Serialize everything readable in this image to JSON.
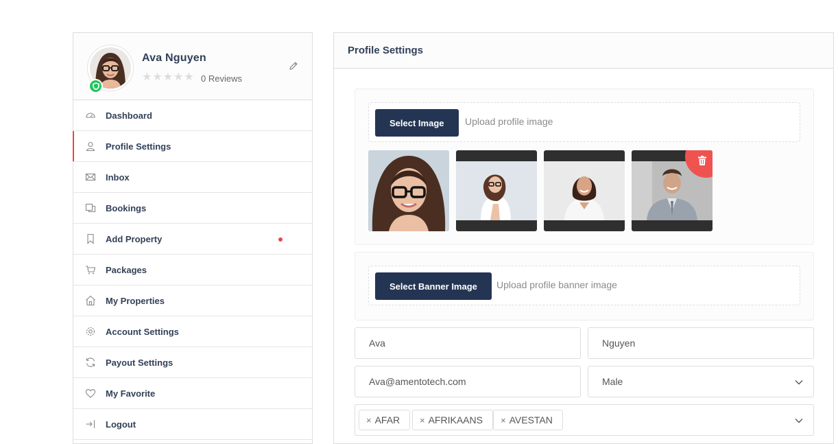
{
  "profile": {
    "name": "Ava Nguyen",
    "reviews": "0 Reviews",
    "rating": 0
  },
  "nav": [
    {
      "label": "Dashboard",
      "icon": "dashboard-icon"
    },
    {
      "label": "Profile Settings",
      "icon": "user-icon",
      "active": true
    },
    {
      "label": "Inbox",
      "icon": "envelope-icon"
    },
    {
      "label": "Bookings",
      "icon": "bookings-icon"
    },
    {
      "label": "Add Property",
      "icon": "bookmark-icon",
      "badge": "dot"
    },
    {
      "label": "Packages",
      "icon": "cart-icon"
    },
    {
      "label": "My Properties",
      "icon": "home-icon"
    },
    {
      "label": "Account Settings",
      "icon": "gear-icon"
    },
    {
      "label": "Payout Settings",
      "icon": "refresh-icon"
    },
    {
      "label": "My Favorite",
      "icon": "heart-icon"
    },
    {
      "label": "Logout",
      "icon": "logout-icon"
    }
  ],
  "panel": {
    "title": "Profile Settings",
    "profile_image": {
      "button": "Select Image",
      "hint": "Upload profile image"
    },
    "banner_image": {
      "button": "Select Banner Image",
      "hint": "Upload profile banner image"
    },
    "form": {
      "first_name": "Ava",
      "last_name": "Nguyen",
      "email": "Ava@amentotech.com",
      "gender": "Male",
      "languages": [
        "AFAR",
        "AFRIKAANS",
        "AVESTAN"
      ]
    }
  },
  "colors": {
    "primary": "#243554",
    "accent": "#ef4444",
    "verified": "#22c55e"
  }
}
